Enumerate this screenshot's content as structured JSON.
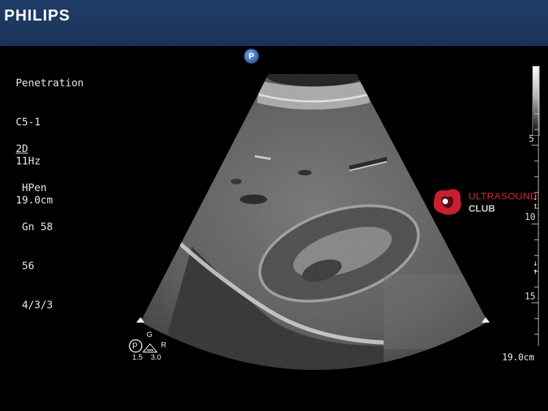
{
  "header": {
    "brand": "PHILIPS"
  },
  "settings": {
    "preset": "Penetration",
    "probe": "C5-1",
    "frame_rate": "11Hz",
    "depth": "19.0cm",
    "mode": "2D",
    "lines": [
      "HPen",
      "Gn 58",
      "56",
      "4/3/3"
    ]
  },
  "badge": {
    "letter": "P"
  },
  "depth_scale": {
    "ticks": [
      "5",
      "10",
      "15"
    ],
    "total": "19.0cm"
  },
  "watermark": {
    "line1": "ULTRASOUND",
    "line2": "CLUB",
    "color": "#d0283a"
  },
  "probe_indicator": {
    "p": "P",
    "g": "G",
    "r": "R",
    "left_value": "1.5",
    "right_value": "3.0"
  },
  "focus_icons": [
    "focus-arrow-icon",
    "focus-arrow-icon"
  ]
}
